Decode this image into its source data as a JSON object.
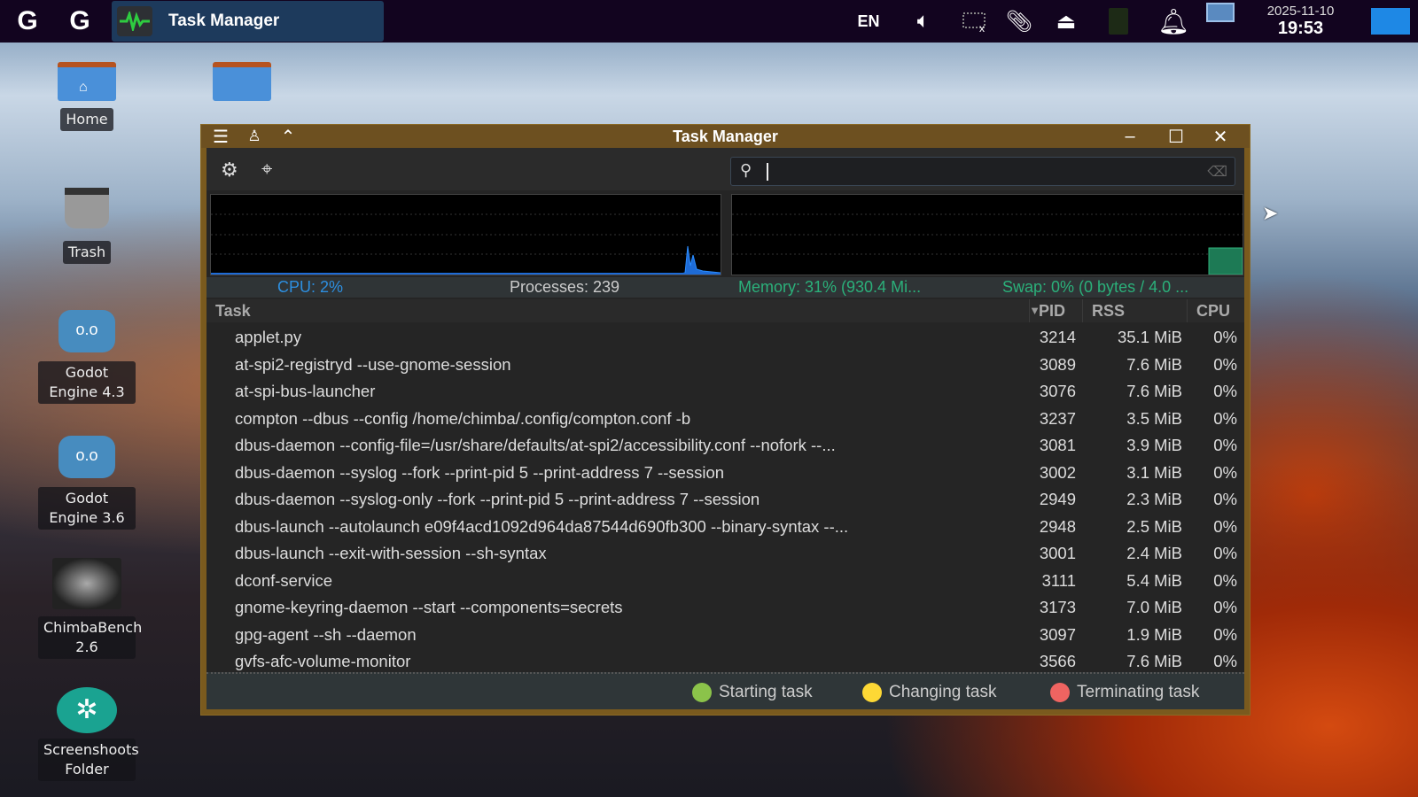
{
  "taskbar": {
    "active_task": "Task Manager",
    "language": "EN",
    "date": "2025-11-10",
    "time": "19:53"
  },
  "desktop": {
    "icons": [
      {
        "label": "Home"
      },
      {
        "label": "Trash"
      },
      {
        "label": "Godot Engine 4.3"
      },
      {
        "label": "Godot Engine 3.6"
      },
      {
        "label": "ChimbaBench 2.6"
      },
      {
        "label": "Screenshoots Folder"
      }
    ]
  },
  "window": {
    "title": "Task Manager",
    "search": {
      "value": ""
    },
    "status": {
      "cpu": "CPU: 2%",
      "processes": "Processes: 239",
      "memory": "Memory: 31% (930.4 Mi...",
      "swap": "Swap: 0% (0 bytes / 4.0 ..."
    },
    "usage": {
      "cpu_percent": 2,
      "memory_percent": 31,
      "swap_percent": 0
    },
    "columns": {
      "task": "Task",
      "pid": "PID",
      "rss": "RSS",
      "cpu": "CPU"
    },
    "rows": [
      {
        "task": "applet.py",
        "pid": "3214",
        "rss": "35.1 MiB",
        "cpu": "0%"
      },
      {
        "task": "at-spi2-registryd --use-gnome-session",
        "pid": "3089",
        "rss": "7.6 MiB",
        "cpu": "0%"
      },
      {
        "task": "at-spi-bus-launcher",
        "pid": "3076",
        "rss": "7.6 MiB",
        "cpu": "0%"
      },
      {
        "task": "compton --dbus --config /home/chimba/.config/compton.conf -b",
        "pid": "3237",
        "rss": "3.5 MiB",
        "cpu": "0%"
      },
      {
        "task": "dbus-daemon --config-file=/usr/share/defaults/at-spi2/accessibility.conf --nofork --...",
        "pid": "3081",
        "rss": "3.9 MiB",
        "cpu": "0%"
      },
      {
        "task": "dbus-daemon --syslog --fork --print-pid 5 --print-address 7 --session",
        "pid": "3002",
        "rss": "3.1 MiB",
        "cpu": "0%"
      },
      {
        "task": "dbus-daemon --syslog-only --fork --print-pid 5 --print-address 7 --session",
        "pid": "2949",
        "rss": "2.3 MiB",
        "cpu": "0%"
      },
      {
        "task": "dbus-launch --autolaunch e09f4acd1092d964da87544d690fb300 --binary-syntax --...",
        "pid": "2948",
        "rss": "2.5 MiB",
        "cpu": "0%"
      },
      {
        "task": "dbus-launch --exit-with-session --sh-syntax",
        "pid": "3001",
        "rss": "2.4 MiB",
        "cpu": "0%"
      },
      {
        "task": "dconf-service",
        "pid": "3111",
        "rss": "5.4 MiB",
        "cpu": "0%"
      },
      {
        "task": "gnome-keyring-daemon --start --components=secrets",
        "pid": "3173",
        "rss": "7.0 MiB",
        "cpu": "0%"
      },
      {
        "task": "gpg-agent --sh --daemon",
        "pid": "3097",
        "rss": "1.9 MiB",
        "cpu": "0%"
      },
      {
        "task": "gvfs-afc-volume-monitor",
        "pid": "3566",
        "rss": "7.6 MiB",
        "cpu": "0%"
      }
    ],
    "legend": [
      {
        "label": "Starting task",
        "color": "#8bc34a"
      },
      {
        "label": "Changing task",
        "color": "#fdd835"
      },
      {
        "label": "Terminating task",
        "color": "#ef6461"
      }
    ]
  }
}
